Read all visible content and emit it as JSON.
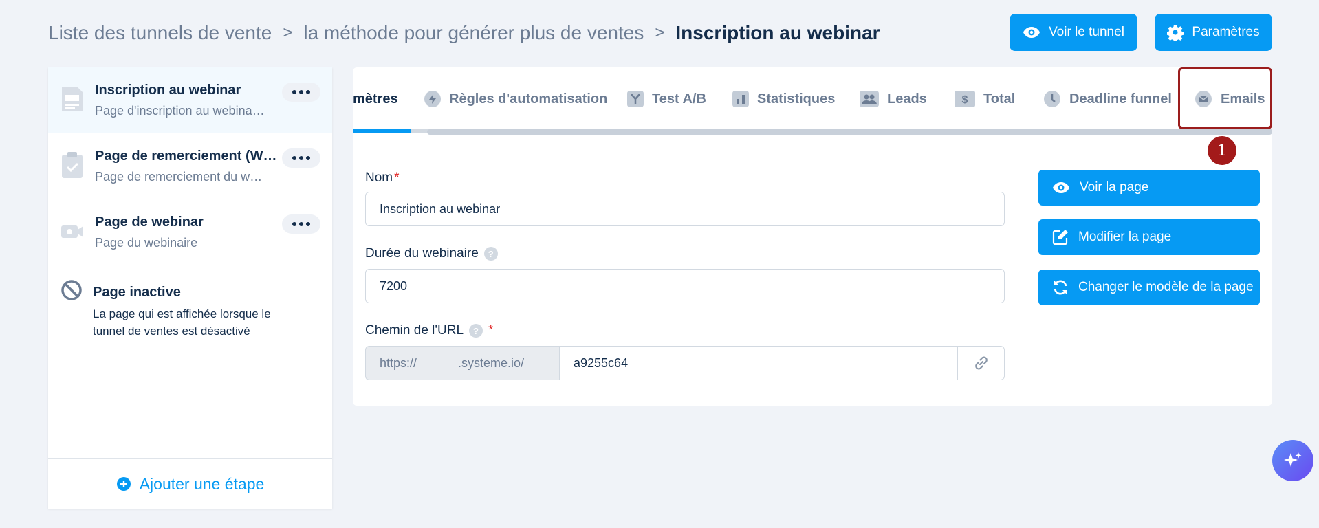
{
  "breadcrumb": {
    "items": [
      "Liste des tunnels de vente",
      "la méthode pour générer plus de ventes"
    ],
    "current": "Inscription au webinar",
    "separator": ">"
  },
  "header": {
    "view_funnel_label": "Voir le tunnel",
    "settings_label": "Paramètres"
  },
  "sidebar": {
    "steps": [
      {
        "title": "Inscription au webinar",
        "subtitle": "Page d'inscription au webina…",
        "icon": "page-layout-icon"
      },
      {
        "title": "Page de remerciement (W…",
        "subtitle": "Page de remerciement du w…",
        "icon": "clipboard-check-icon"
      },
      {
        "title": "Page de webinar",
        "subtitle": "Page du webinaire",
        "icon": "video-camera-icon"
      }
    ],
    "inactive": {
      "title": "Page inactive",
      "description": "La page qui est affichée lorsque le tunnel de ventes est désactivé"
    },
    "add_step_label": "Ajouter une étape"
  },
  "tabs": [
    {
      "label": "mètres"
    },
    {
      "label": "Règles d'automatisation",
      "icon": "bolt-icon"
    },
    {
      "label": "Test A/B",
      "icon": "split-icon"
    },
    {
      "label": "Statistiques",
      "icon": "bar-chart-icon"
    },
    {
      "label": "Leads",
      "icon": "users-icon"
    },
    {
      "label": "Total",
      "icon": "dollar-icon"
    },
    {
      "label": "Deadline funnel",
      "icon": "clock-icon"
    },
    {
      "label": "Emails",
      "icon": "envelope-icon"
    }
  ],
  "annotation": {
    "step_number": "1"
  },
  "form": {
    "name_label": "Nom",
    "name_value": "Inscription au webinar",
    "duration_label": "Durée du webinaire",
    "duration_value": "7200",
    "url_label": "Chemin de l'URL",
    "url_prefix": "https://            .systeme.io/",
    "url_value": "a9255c64",
    "required_mark": "*",
    "help_mark": "?"
  },
  "actions": {
    "view_page_label": "Voir la page",
    "edit_page_label": "Modifier la page",
    "change_template_label": "Changer le modèle de la page"
  },
  "colors": {
    "primary": "#069af3",
    "text_dark": "#142d4b",
    "text_muted": "#6c7c93",
    "background": "#f0f3f8",
    "annotation": "#9b1d1d"
  }
}
